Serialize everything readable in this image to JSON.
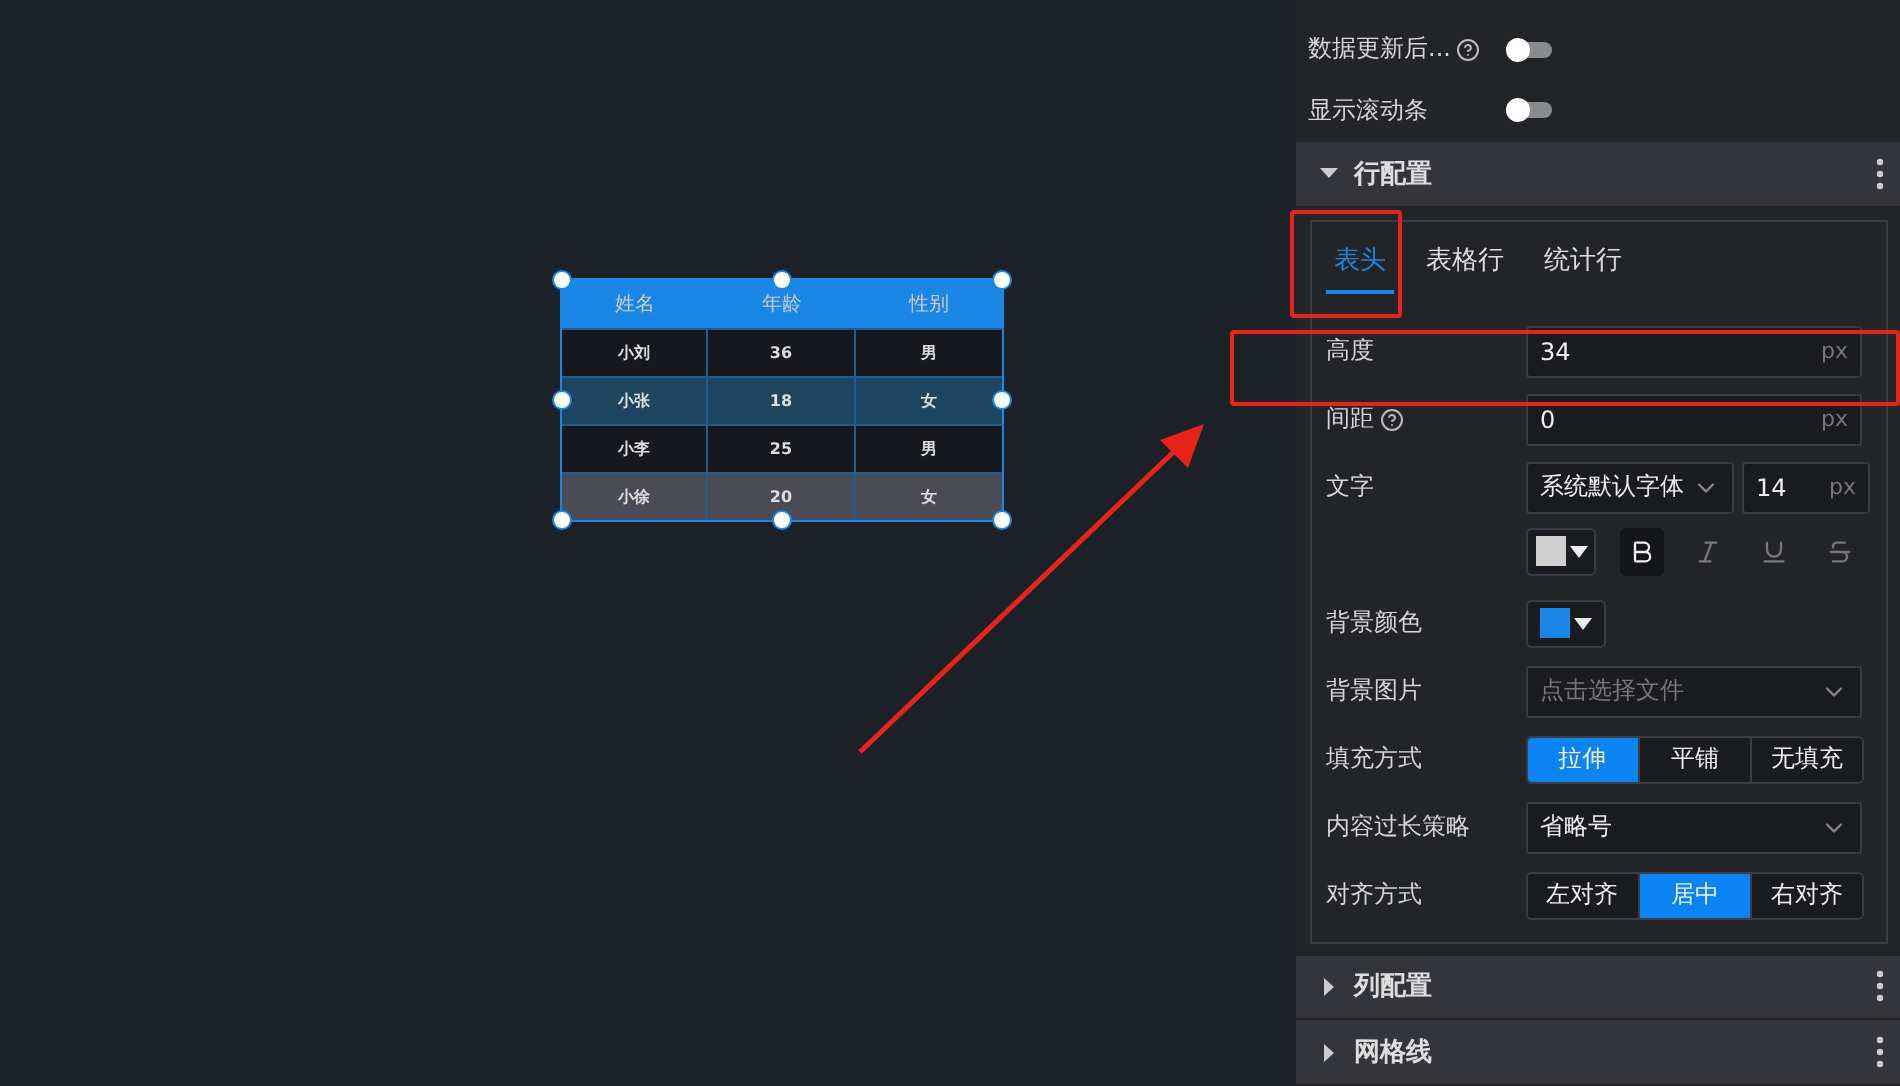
{
  "canvas": {
    "table_widget": {
      "columns": [
        "姓名",
        "年龄",
        "性别"
      ],
      "rows": [
        {
          "cells": [
            "小刘",
            "36",
            "男"
          ],
          "color": "#16181d"
        },
        {
          "cells": [
            "小张",
            "18",
            "女"
          ],
          "color": "#1d4560"
        },
        {
          "cells": [
            "小李",
            "25",
            "男"
          ],
          "color": "#16181d"
        },
        {
          "cells": [
            "小徐",
            "20",
            "女"
          ],
          "color": "#4a4b55"
        }
      ],
      "selected": true
    },
    "annotations": [
      {
        "kind": "box"
      },
      {
        "kind": "box"
      },
      {
        "kind": "arrow"
      }
    ]
  },
  "panel": {
    "toggles": [
      {
        "label": "数据更新后...",
        "help": true,
        "on": false
      },
      {
        "label": "显示滚动条",
        "help": false,
        "on": false
      }
    ],
    "sections": [
      {
        "title": "行配置",
        "expanded": true,
        "tabs": [
          {
            "label": "表头",
            "selected": true
          },
          {
            "label": "表格行",
            "selected": false
          },
          {
            "label": "统计行",
            "selected": false
          }
        ],
        "rows": [
          {
            "kind": "number",
            "label": "高度",
            "help": false,
            "value": "34",
            "unit": "px"
          },
          {
            "kind": "number",
            "label": "间距",
            "help": true,
            "value": "0",
            "unit": "px"
          },
          {
            "kind": "font",
            "label": "文字",
            "font": "系统默认字体",
            "size": "14",
            "unit": "px",
            "color": "#d0d0d0",
            "styles": [
              {
                "kind": "bold",
                "selected": true
              },
              {
                "kind": "italic",
                "selected": false
              },
              {
                "kind": "underline",
                "selected": false
              },
              {
                "kind": "strike",
                "selected": false
              }
            ]
          },
          {
            "kind": "color",
            "label": "背景颜色",
            "color": "#1a86e5"
          },
          {
            "kind": "select",
            "label": "背景图片",
            "placeholder": "点击选择文件"
          },
          {
            "kind": "segments",
            "label": "填充方式",
            "options": [
              {
                "label": "拉伸",
                "selected": true
              },
              {
                "label": "平铺",
                "selected": false
              },
              {
                "label": "无填充",
                "selected": false
              }
            ]
          },
          {
            "kind": "select",
            "label": "内容过长策略",
            "value": "省略号"
          },
          {
            "kind": "segments",
            "label": "对齐方式",
            "options": [
              {
                "label": "左对齐",
                "selected": false
              },
              {
                "label": "居中",
                "selected": true
              },
              {
                "label": "右对齐",
                "selected": false
              }
            ]
          }
        ]
      },
      {
        "title": "列配置",
        "expanded": false
      },
      {
        "title": "网格线",
        "expanded": false
      }
    ]
  }
}
